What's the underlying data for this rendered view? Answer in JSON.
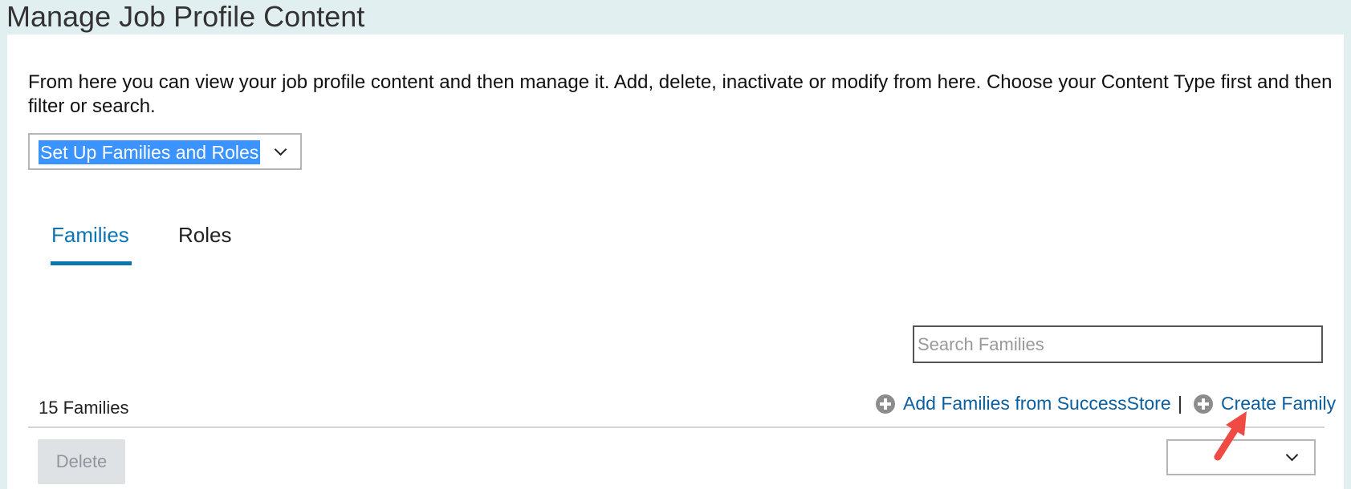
{
  "page": {
    "title": "Manage Job Profile Content",
    "intro": "From here you can view your job profile content and then manage it. Add, delete, inactivate or modify from here. Choose your Content Type first and then filter or search."
  },
  "content_type": {
    "selected": "Set Up Families and Roles"
  },
  "tabs": [
    {
      "label": "Families",
      "active": true
    },
    {
      "label": "Roles",
      "active": false
    }
  ],
  "search": {
    "placeholder": "Search Families",
    "value": ""
  },
  "list": {
    "count_label": "15 Families",
    "add_from_store_label": "Add Families from SuccessStore",
    "separator": "|",
    "create_label": "Create Family",
    "delete_label": "Delete",
    "sort_value": ""
  },
  "colors": {
    "accent": "#0b74b1",
    "link": "#0a5f9e",
    "background": "#e1eff1",
    "selection": "#3b93ff",
    "annotation_arrow": "#f04a44"
  },
  "icons": {
    "add": "plus-circle-icon",
    "dropdown": "chevron-down-icon",
    "annotation": "red-arrow-icon"
  }
}
